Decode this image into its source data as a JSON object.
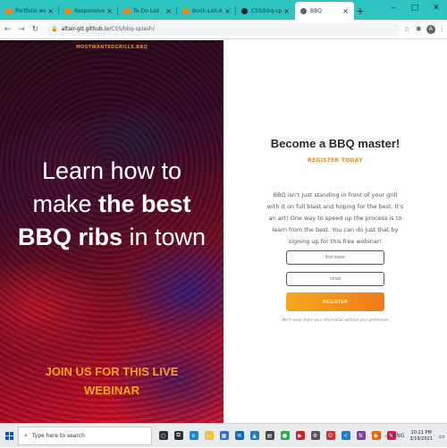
{
  "browser": {
    "tabs": [
      {
        "label": "Portfolio website",
        "fav_color": "#e7891b",
        "active": false
      },
      {
        "label": "Responsive-Website",
        "fav_color": "#e7891b",
        "active": false
      },
      {
        "label": "To-Do List",
        "fav_color": "#e7891b",
        "active": false
      },
      {
        "label": "Book-List-App",
        "fav_color": "#e7891b",
        "active": false
      },
      {
        "label": "CSS/bbq-splash at m",
        "fav_color": "#222222",
        "active": false
      },
      {
        "label": "BBQ",
        "fav_color": "#5f6368",
        "active": true
      }
    ],
    "new_tab": "+",
    "window": {
      "minimize": "–",
      "maximize": "□",
      "close": "✕"
    },
    "url_host": "altair-git.github.io",
    "url_path": "/CSS/bbq-splash/"
  },
  "page": {
    "brand": "MOSTWANTEDGRILLS.BBQ",
    "headline_line1": "Learn how to",
    "headline_line2_pre": "make ",
    "headline_line2_bold": "the best",
    "headline_line3_bold": "BBQ ribs",
    "headline_line3_post": " in town",
    "cta_line1": "JOIN US FOR THIS LIVE",
    "cta_line2": "WEBINAR",
    "title": "Become a BBQ master!",
    "subtitle": "REGISTER TODAY",
    "body": "BBQ isn't just standing in front of your grill with it on full blast and hoping for the best. It's an art! One way to speed up the process is to learn from the best. You can do just that by signing up for this free webinar!",
    "first_name_placeholder": "first name",
    "email_placeholder": "email",
    "register_button": "REGISTER",
    "disclaimer": "We'll never share your information without your permission"
  },
  "taskbar": {
    "search_placeholder": "Type here to search",
    "apps": [
      {
        "icon": "cortana-icon",
        "color": "#333333",
        "glyph": "○"
      },
      {
        "icon": "task-view-icon",
        "color": "#333333",
        "glyph": "⧉"
      },
      {
        "icon": "edge-icon",
        "color": "#1e88c8",
        "glyph": "e"
      },
      {
        "icon": "file-explorer-icon",
        "color": "#f2c037",
        "glyph": "▭"
      },
      {
        "icon": "store-icon",
        "color": "#2d6fd1",
        "glyph": "▦"
      },
      {
        "icon": "mail-icon",
        "color": "#1565c0",
        "glyph": "✉"
      },
      {
        "icon": "photos-icon",
        "color": "#2277c8",
        "glyph": "▲"
      },
      {
        "icon": "calculator-icon",
        "color": "#444444",
        "glyph": "▤"
      },
      {
        "icon": "chrome-icon",
        "color": "#34a853",
        "glyph": "●"
      },
      {
        "icon": "media-icon",
        "color": "#c62828",
        "glyph": "▶"
      },
      {
        "icon": "settings-app-icon",
        "color": "#555555",
        "glyph": "⚙"
      },
      {
        "icon": "opera-icon",
        "color": "#d32f2f",
        "glyph": "O"
      },
      {
        "icon": "vscode-icon",
        "color": "#1e7bd1",
        "glyph": "≺"
      },
      {
        "icon": "notes-icon",
        "color": "#7b3fa0",
        "glyph": "N"
      },
      {
        "icon": "firefox-icon",
        "color": "#ef6c00",
        "glyph": "◉"
      },
      {
        "icon": "paint-icon",
        "color": "#d81b60",
        "glyph": "✎"
      }
    ],
    "language": "ENG",
    "time": "10:21 PM",
    "date": "3/19/2021"
  }
}
